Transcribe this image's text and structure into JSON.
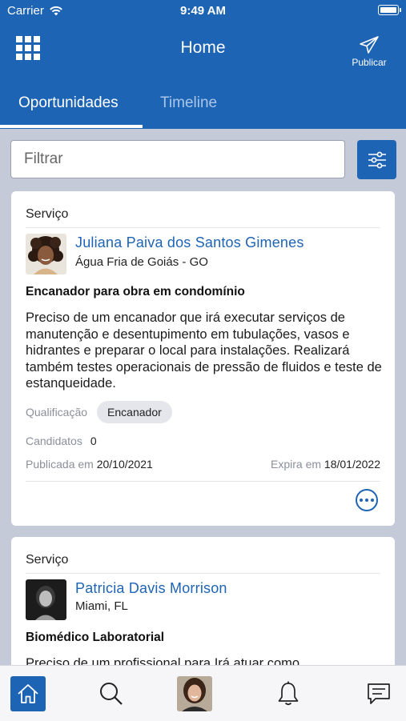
{
  "status_bar": {
    "carrier": "Carrier",
    "time": "9:49 AM"
  },
  "header": {
    "title": "Home",
    "publish_label": "Publicar"
  },
  "tabs": [
    {
      "label": "Oportunidades",
      "active": true
    },
    {
      "label": "Timeline",
      "active": false
    }
  ],
  "filter": {
    "placeholder": "Filtrar",
    "value": ""
  },
  "labels": {
    "qualification": "Qualificação",
    "candidates": "Candidatos",
    "published": "Publicada em",
    "expires": "Expira em"
  },
  "posts": [
    {
      "category": "Serviço",
      "author": "Juliana Paiva dos Santos Gimenes",
      "location": "Água Fria de Goiás - GO",
      "title": "Encanador para obra em condomínio",
      "description": "Preciso de um encanador que irá executar serviços de manutenção e desentupimento em tubulações, vasos e hidrantes e preparar o local para instalações. Realizará também testes operacionais de pressão de fluidos e teste de estanqueidade.",
      "qualification": "Encanador",
      "candidates": "0",
      "published": "20/10/2021",
      "expires": "18/01/2022"
    },
    {
      "category": "Serviço",
      "author": "Patricia Davis Morrison",
      "location": "Miami, FL",
      "title": "Biomédico Laboratorial",
      "description": "Preciso de um profissional para Irá atuar como"
    }
  ],
  "colors": {
    "brand": "#1e64b4",
    "background": "#c5cad9"
  },
  "bottom_nav": [
    "home-icon",
    "search-icon",
    "profile-avatar",
    "bell-icon",
    "chat-icon"
  ]
}
